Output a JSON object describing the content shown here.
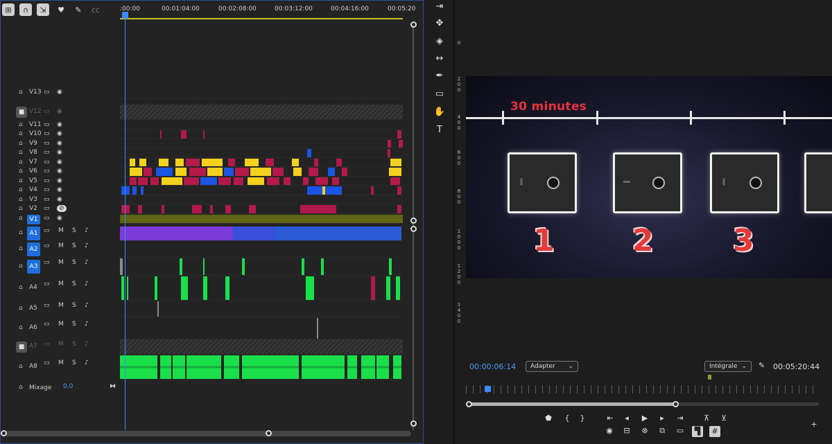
{
  "timeline": {
    "ruler_ticks": [
      ":00:00",
      "00:01:04:00",
      "00:02:08:00",
      "00:03:12:00",
      "00:04:16:00",
      "00:05:20"
    ],
    "toolbar_icons": [
      "insert-snap-icon",
      "magnet-icon",
      "linked-selection-icon",
      "marker-icon",
      "wrench-icon",
      "captions-icon"
    ],
    "tracks": [
      {
        "label": "V13",
        "kind": "video"
      },
      {
        "label": "V12",
        "kind": "video",
        "locked": true
      },
      {
        "label": "V11",
        "kind": "video"
      },
      {
        "label": "V10",
        "kind": "video"
      },
      {
        "label": "V9",
        "kind": "video"
      },
      {
        "label": "V8",
        "kind": "video"
      },
      {
        "label": "V7",
        "kind": "video"
      },
      {
        "label": "V6",
        "kind": "video"
      },
      {
        "label": "V5",
        "kind": "video"
      },
      {
        "label": "V4",
        "kind": "video"
      },
      {
        "label": "V3",
        "kind": "video"
      },
      {
        "label": "V2",
        "kind": "video",
        "hidden": true
      },
      {
        "label": "V1",
        "kind": "video",
        "selected": true
      },
      {
        "label": "A1",
        "kind": "audio",
        "selected": true
      },
      {
        "label": "A2",
        "kind": "audio",
        "selected": true
      },
      {
        "label": "A3",
        "kind": "audio",
        "selected": true
      },
      {
        "label": "A4",
        "kind": "audio"
      },
      {
        "label": "A5",
        "kind": "audio"
      },
      {
        "label": "A6",
        "kind": "audio"
      },
      {
        "label": "A7",
        "kind": "audio",
        "locked": true
      },
      {
        "label": "A8",
        "kind": "audio"
      }
    ],
    "mute_label": "M",
    "solo_label": "S",
    "mix": {
      "label": "Mixage",
      "value": "0,0"
    }
  },
  "monitor": {
    "video_text": "30 minutes",
    "video_numbers": [
      "1",
      "2",
      "3"
    ],
    "vertical_ruler": [
      "0",
      "2\n0\n0",
      "4\n0\n0",
      "6\n0\n0",
      "8\n0\n0",
      "1\n0\n0\n0",
      "1\n2\n0\n0",
      "1\n4\n0\n0"
    ],
    "timecode_current": "00:00:06:14",
    "fit_select": "Adapter",
    "quality_select": "Intégrale",
    "timecode_duration": "00:05:20:44",
    "playhead_fraction": 0.02,
    "scroll_fraction": 0.59
  },
  "colors": {
    "accent": "#3d8af7",
    "video_clip_red": "#b3194b",
    "video_clip_yellow": "#f3d11d",
    "video_clip_blue": "#1a55e6",
    "audio_green": "#19e04a",
    "audio_purple": "#7b3bd9",
    "text_red": "#e8313b"
  }
}
